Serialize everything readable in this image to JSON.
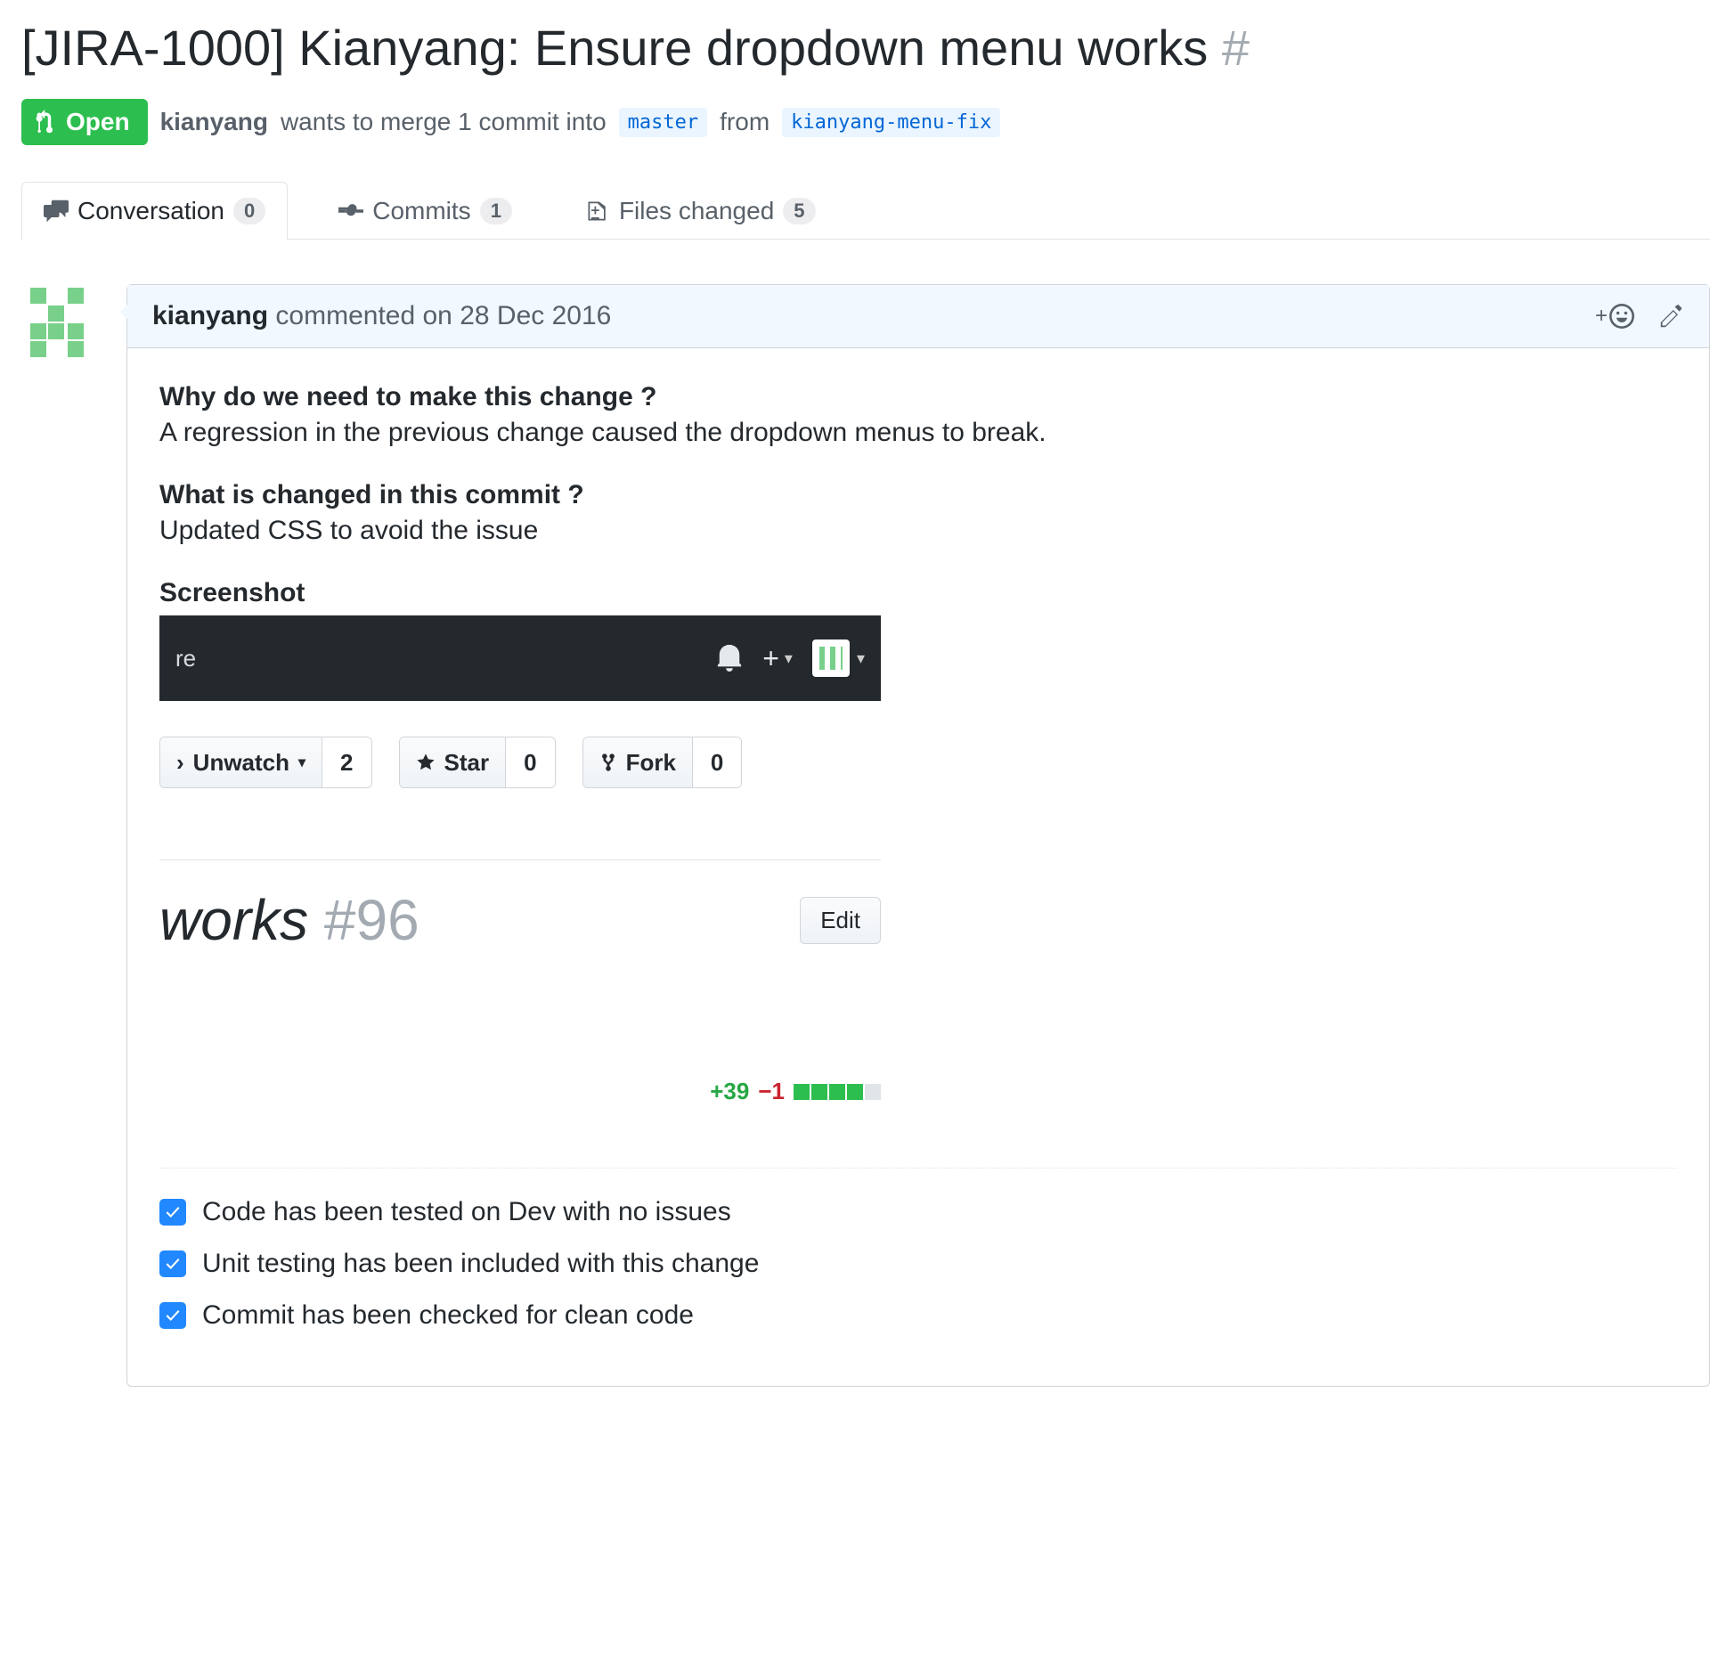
{
  "title": "[JIRA-1000] Kianyang: Ensure dropdown menu works",
  "title_hash": "#",
  "state": "Open",
  "merge": {
    "author": "kianyang",
    "text_before": "wants to merge 1 commit into",
    "base_branch": "master",
    "from_text": "from",
    "head_branch": "kianyang-menu-fix"
  },
  "tabs": {
    "conversation": {
      "label": "Conversation",
      "count": "0"
    },
    "commits": {
      "label": "Commits",
      "count": "1"
    },
    "files": {
      "label": "Files changed",
      "count": "5"
    }
  },
  "comment": {
    "author": "kianyang",
    "verb": "commented",
    "date_prefix": "on",
    "date": "28 Dec 2016",
    "q1": "Why do we need to make this change ?",
    "a1": "A regression in the previous change caused the dropdown menus to break.",
    "q2": "What is changed in this commit ?",
    "a2": "Updated CSS to avoid the issue",
    "screenshot_heading": "Screenshot",
    "ss": {
      "leftText": "re",
      "social": {
        "unwatch": "Unwatch",
        "unwatch_count": "2",
        "star": "Star",
        "star_count": "0",
        "fork": "Fork",
        "fork_count": "0"
      },
      "title_text": "works",
      "title_num": "#96",
      "edit": "Edit",
      "additions": "+39",
      "deletions": "−1"
    },
    "checklist": [
      "Code has been tested on Dev with no issues",
      "Unit testing has been included with this change",
      "Commit has been checked for clean code"
    ]
  }
}
